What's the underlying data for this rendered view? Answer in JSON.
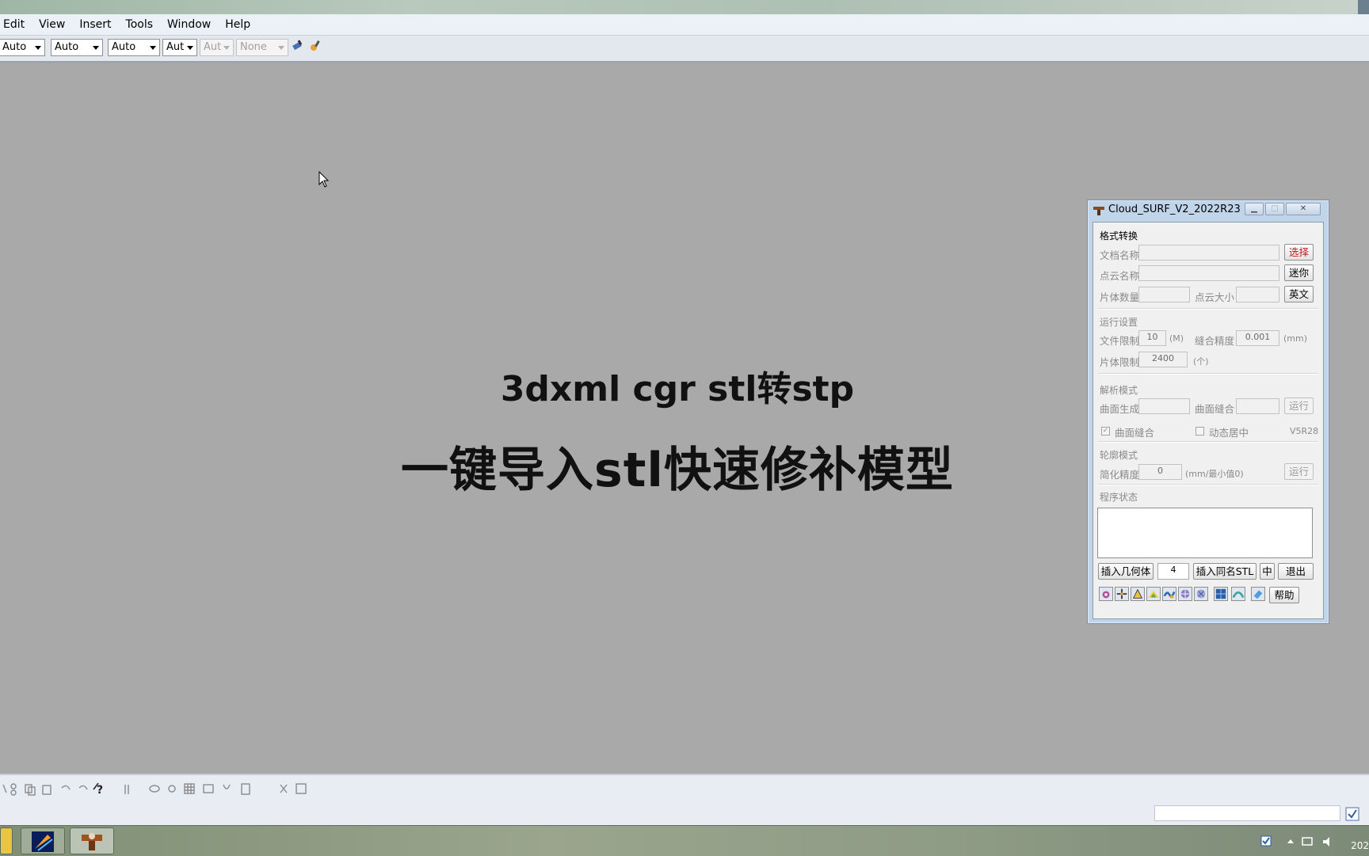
{
  "menu": [
    "Edit",
    "View",
    "Insert",
    "Tools",
    "Window",
    "Help"
  ],
  "toolbar": {
    "combos": [
      "Auto",
      "Auto",
      "Auto",
      "Aut",
      "Aut",
      "None"
    ]
  },
  "banner": {
    "line1": "3dxml cgr stl转stp",
    "line2": "一键导入stl快速修补模型"
  },
  "dialog": {
    "title": "Cloud_SURF_V2_2022R23",
    "format_section": "格式转换",
    "doc_name_label": "文档名称",
    "select_button": "选择",
    "cloud_name_label": "点云名称",
    "mini_button": "迷你",
    "patch_count_label": "片体数量",
    "cloud_size_label": "点云大小",
    "english_button": "英文",
    "run_section": "运行设置",
    "file_limit_label": "文件限制",
    "file_limit_value": "10",
    "file_limit_unit": "(M)",
    "stitch_precision_label": "缝合精度",
    "stitch_precision_value": "0.001",
    "stitch_precision_unit": "(mm)",
    "patch_limit_label": "片体限制",
    "patch_limit_value": "2400",
    "patch_limit_unit": "(个)",
    "parse_section": "解析模式",
    "surface_gen_label": "曲面生成",
    "surface_stitch_label": "曲面缝合",
    "run_button_1": "运行",
    "checkbox_stitch_label": "曲面缝合",
    "checkbox_dynamic_label": "动态居中",
    "version_label": "V5R28",
    "contour_section": "轮廓模式",
    "simplify_label": "简化精度",
    "simplify_value": "0",
    "simplify_unit": "(mm/最小值0)",
    "run_button_2": "运行",
    "status_section": "程序状态",
    "insert_geo_button": "插入几何体",
    "insert_count_value": "4",
    "insert_stl_button": "插入同名STL",
    "zhong_button": "中",
    "exit_button": "退出",
    "help_button": "帮助"
  },
  "taskbar": {
    "clock": "202"
  }
}
